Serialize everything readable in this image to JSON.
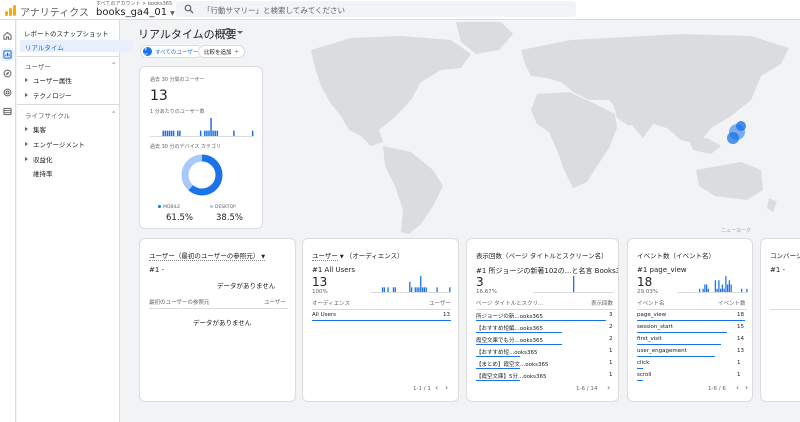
{
  "app": {
    "title": "アナリティクス",
    "account_crumb": "すべてのアカウント > books365",
    "property_name": "books_ga4_01",
    "search_placeholder": "「行動サマリー」と検索してみてください"
  },
  "rail": [
    "home-icon",
    "reports-icon",
    "explore-icon",
    "advertising-icon",
    "configure-icon"
  ],
  "sidenav": {
    "snapshot": "レポートのスナップショット",
    "realtime": "リアルタイム",
    "user_section": "ユーザー",
    "user_items": [
      "ユーザー属性",
      "テクノロジー"
    ],
    "lifecycle_section": "ライフサイクル",
    "lifecycle_items": [
      "集客",
      "エンゲージメント",
      "収益化"
    ],
    "retention": "維持率"
  },
  "page": {
    "title": "リアルタイムの概要",
    "chip_avatar": "すて",
    "chip_all_users": "すべてのユーザー",
    "chip_compare": "比較を追加"
  },
  "colors": {
    "accent": "#1a73e8",
    "light_accent": "#a8c7fa",
    "map_land": "#dadce0",
    "page_bg": "#f1f3f4"
  },
  "kpi": {
    "users_30min_label": "過去 30 分間のユーザー",
    "users_30min_value": "13",
    "per_minute_label": "1 分あたりのユーザー数",
    "per_minute_bars": [
      0,
      0,
      0,
      0,
      0,
      0,
      1,
      1,
      1,
      1,
      1,
      1,
      0,
      1,
      1,
      0,
      0,
      0,
      0,
      0,
      0,
      0,
      0,
      0,
      1,
      0,
      1,
      1,
      1,
      3,
      1,
      1,
      1,
      0,
      0,
      0,
      0,
      0,
      0,
      0,
      1,
      0,
      0,
      0,
      0,
      0,
      0,
      0,
      0,
      1
    ],
    "device_label": "過去 30 分のデバイス カテゴリ",
    "device_mobile_label": "MOBILE",
    "device_mobile_pct": "61.5%",
    "device_mobile_share": 0.615,
    "device_desktop_label": "DESKTOP",
    "device_desktop_pct": "38.5%"
  },
  "cards": {
    "source": {
      "title": "ユーザー（最初のユーザーの参照元）",
      "rank": "#1 -",
      "no_data": "データがありません",
      "col1": "最初のユーザーの参照元",
      "col2": "ユーザー",
      "no_data_table": "データがありません"
    },
    "audience": {
      "title_dim": "ユーザー",
      "title_rest": "（オーディエンス）",
      "rank": "#1 All Users",
      "value": "13",
      "pct": "100%",
      "bars": [
        0,
        0,
        0,
        0,
        0,
        0,
        1,
        1,
        0,
        1,
        0,
        0,
        1,
        1,
        0,
        0,
        0,
        0,
        0,
        0,
        0,
        2,
        1,
        0,
        1,
        1,
        1,
        3,
        1,
        1,
        1,
        0,
        0,
        0,
        0,
        0,
        1,
        0,
        0,
        0,
        0,
        0,
        0,
        1
      ],
      "col1": "オーディエンス",
      "col2": "ユーザー",
      "rows": [
        {
          "name": "All Users",
          "value": "13"
        }
      ],
      "pagination": "1-1 / 1"
    },
    "pages": {
      "title": "表示回数（ページ タイトルとスクリーン名）",
      "rank": "#1 所ジョージの新著102の...と名言 Books365",
      "value": "3",
      "pct": "16.67%",
      "bars": [
        0,
        0,
        0,
        0,
        0,
        0,
        0,
        0,
        0,
        0,
        0,
        0,
        0,
        0,
        0,
        0,
        0,
        0,
        0,
        0,
        0,
        0,
        3,
        0,
        0,
        0,
        0,
        0,
        0,
        0,
        0,
        0,
        0,
        0,
        0,
        0,
        0,
        0,
        0,
        0,
        0,
        0,
        0,
        0
      ],
      "col1": "ページ タイトルとスクリ...",
      "col2": "表示回数",
      "rows": [
        {
          "name": "所ジョージの新...ooks365",
          "value": "3"
        },
        {
          "name": "【おすすめ短編...ooks365",
          "value": "2"
        },
        {
          "name": "霞空文庫でも分...ooks365",
          "value": "2"
        },
        {
          "name": "【おすすめ短...ooks365",
          "value": "1"
        },
        {
          "name": "【まとめ】霞空文...ooks365",
          "value": "1"
        },
        {
          "name": "【霞空文庫】5分...ooks365",
          "value": "1"
        }
      ],
      "pagination": "1-6 / 14"
    },
    "events": {
      "title": "イベント数（イベント名）",
      "rank": "#1 page_view",
      "value": "18",
      "pct": "29.03%",
      "bars": [
        0,
        0,
        0,
        0,
        0,
        0,
        0,
        0,
        0,
        0,
        0,
        0,
        1,
        0,
        1,
        2,
        2,
        1,
        0,
        0,
        0,
        3,
        1,
        3,
        1,
        2,
        1,
        4,
        2,
        3,
        2,
        0,
        0,
        0,
        0,
        0,
        1,
        0,
        0,
        1
      ],
      "col1": "イベント名",
      "col2": "イベント数",
      "rows": [
        {
          "name": "page_view",
          "value": "18"
        },
        {
          "name": "session_start",
          "value": "15"
        },
        {
          "name": "first_visit",
          "value": "14"
        },
        {
          "name": "user_engagement",
          "value": "13"
        },
        {
          "name": "click",
          "value": "1"
        },
        {
          "name": "scroll",
          "value": "1"
        }
      ],
      "pagination": "1-6 / 6"
    },
    "conversions": {
      "title": "コンバージョン",
      "rank": "#1 -"
    }
  },
  "map": {
    "attribution": "ニューヨーク",
    "highlighted_region": "Japan"
  }
}
